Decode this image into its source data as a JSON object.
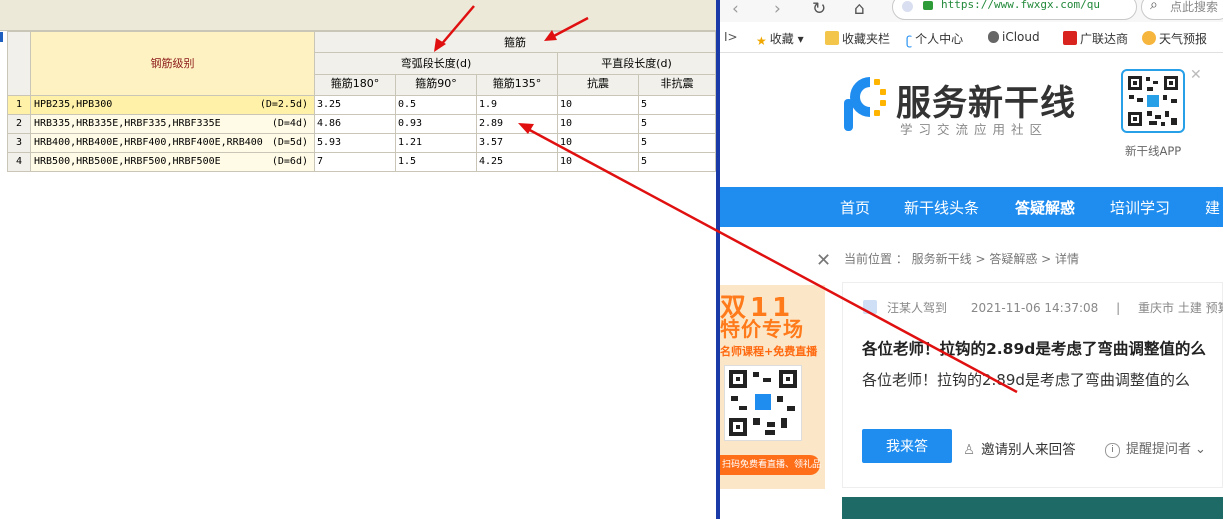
{
  "table": {
    "header": {
      "grade": "钢筋级别",
      "stirrup": "箍筋",
      "arc_group": "弯弧段长度(d)",
      "straight_group": "平直段长度(d)",
      "cols": [
        "箍筋180°",
        "箍筋90°",
        "箍筋135°",
        "抗震",
        "非抗震"
      ]
    },
    "rows": [
      {
        "num": "1",
        "grade": "HPB235,HPB300",
        "d": "(D=2.5d)",
        "v180": "3.25",
        "v90": "0.5",
        "v135": "1.9",
        "seismic": "10",
        "nonseismic": "5"
      },
      {
        "num": "2",
        "grade": "HRB335,HRB335E,HRBF335,HRBF335E",
        "d": "(D=4d)",
        "v180": "4.86",
        "v90": "0.93",
        "v135": "2.89",
        "seismic": "10",
        "nonseismic": "5"
      },
      {
        "num": "3",
        "grade": "HRB400,HRB400E,HRBF400,HRBF400E,RRB400",
        "d": "(D=5d)",
        "v180": "5.93",
        "v90": "1.21",
        "v135": "3.57",
        "seismic": "10",
        "nonseismic": "5"
      },
      {
        "num": "4",
        "grade": "HRB500,HRB500E,HRBF500,HRBF500E",
        "d": "(D=6d)",
        "v180": "7",
        "v90": "1.5",
        "v135": "4.25",
        "seismic": "10",
        "nonseismic": "5"
      }
    ]
  },
  "browser": {
    "url": "https://www.fwxgx.com/qu",
    "search_placeholder": "点此搜索",
    "bookmarks": [
      "收藏",
      "收藏夹栏",
      "个人中心",
      "iCloud",
      "广联达商",
      "天气预报"
    ]
  },
  "site": {
    "logo_title": "服务新干线",
    "logo_sub": "学习交流应用社区",
    "app_label": "新干线APP",
    "nav": [
      "首页",
      "新干线头条",
      "答疑解惑",
      "培训学习",
      "建"
    ],
    "breadcrumb": "当前位置 ： 服务新干线 > 答疑解惑 > 详情",
    "ad": {
      "t1": "双11",
      "t2": "特价专场",
      "t3": "名师课程+免费直播",
      "t4": "扫码免费看直播、领礼品"
    },
    "question": {
      "author": "汪某人驾到",
      "datetime": "2021-11-06 14:37:08",
      "separator": "|",
      "location": "重庆市 土建 预算",
      "title": "各位老师！拉钩的2.89d是考虑了弯曲调整值的么",
      "body": "各位老师！拉钩的2.89d是考虑了弯曲调整值的么",
      "answer_btn": "我来答",
      "invite": "邀请别人来回答",
      "remind": "提醒提问者"
    }
  },
  "colors": {
    "nav_blue": "#1f8df0",
    "annotation_red": "#e01010",
    "row_highlight": "#fff1a8",
    "divider": "#1a3aa8"
  }
}
